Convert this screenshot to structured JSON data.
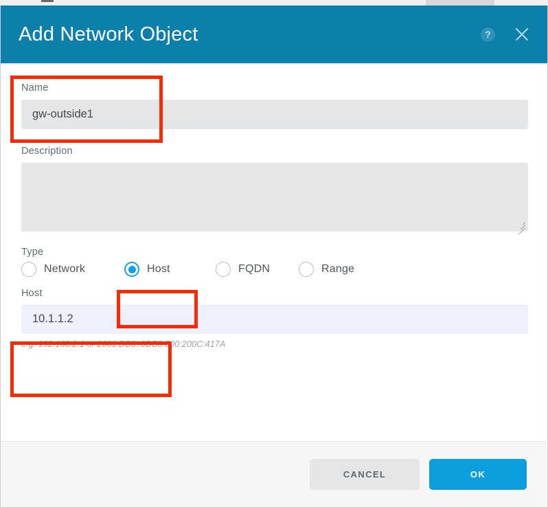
{
  "dialog": {
    "title": "Add Network Object",
    "help_icon": "help-circle-icon",
    "close_icon": "close-icon",
    "header_color": "#0d7fab",
    "accent_color": "#0d9edd"
  },
  "fields": {
    "name": {
      "label": "Name",
      "value": "gw-outside1",
      "placeholder": ""
    },
    "description": {
      "label": "Description",
      "value": "",
      "placeholder": ""
    },
    "type": {
      "label": "Type",
      "selected": "Host",
      "options": [
        {
          "label": "Network",
          "checked": false
        },
        {
          "label": "Host",
          "checked": true
        },
        {
          "label": "FQDN",
          "checked": false
        },
        {
          "label": "Range",
          "checked": false
        }
      ]
    },
    "host": {
      "label": "Host",
      "value": "10.1.1.2",
      "placeholder": "",
      "hint": "e.g. 192.168.2.1 or 2001:DB8::0DB8:800:200C:417A"
    }
  },
  "footer": {
    "cancel_label": "CANCEL",
    "ok_label": "OK"
  },
  "annotations": {
    "highlight_color": "#fa2a05",
    "boxes": [
      {
        "name": "name-field-highlight"
      },
      {
        "name": "host-radio-highlight"
      },
      {
        "name": "host-field-highlight"
      }
    ]
  }
}
